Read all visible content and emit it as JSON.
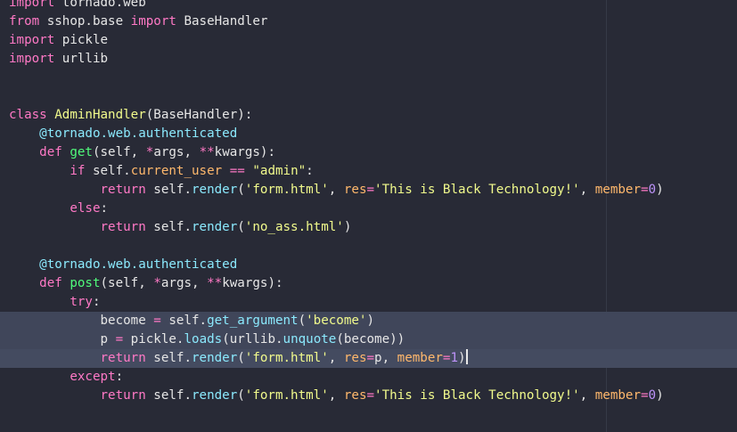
{
  "editor": {
    "language": "python",
    "lines": [
      {
        "tokens": [
          {
            "t": "import",
            "c": "kw"
          },
          {
            "t": " tornado.web",
            "c": "plain"
          }
        ]
      },
      {
        "tokens": [
          {
            "t": "from",
            "c": "kw"
          },
          {
            "t": " sshop.base ",
            "c": "plain"
          },
          {
            "t": "import",
            "c": "kw"
          },
          {
            "t": " BaseHandler",
            "c": "plain"
          }
        ]
      },
      {
        "tokens": [
          {
            "t": "import",
            "c": "kw"
          },
          {
            "t": " pickle",
            "c": "plain"
          }
        ]
      },
      {
        "tokens": [
          {
            "t": "import",
            "c": "kw"
          },
          {
            "t": " urllib",
            "c": "plain"
          }
        ]
      },
      {
        "tokens": []
      },
      {
        "tokens": []
      },
      {
        "tokens": [
          {
            "t": "class",
            "c": "kw"
          },
          {
            "t": " ",
            "c": "plain"
          },
          {
            "t": "AdminHandler",
            "c": "cls"
          },
          {
            "t": "(BaseHandler):",
            "c": "plain"
          }
        ]
      },
      {
        "tokens": [
          {
            "t": "    ",
            "c": "plain"
          },
          {
            "t": "@tornado.web.authenticated",
            "c": "fn"
          }
        ]
      },
      {
        "tokens": [
          {
            "t": "    ",
            "c": "plain"
          },
          {
            "t": "def",
            "c": "kw"
          },
          {
            "t": " ",
            "c": "plain"
          },
          {
            "t": "get",
            "c": "dec"
          },
          {
            "t": "(self, ",
            "c": "plain"
          },
          {
            "t": "*",
            "c": "op"
          },
          {
            "t": "args, ",
            "c": "plain"
          },
          {
            "t": "**",
            "c": "op"
          },
          {
            "t": "kwargs):",
            "c": "plain"
          }
        ]
      },
      {
        "tokens": [
          {
            "t": "        ",
            "c": "plain"
          },
          {
            "t": "if",
            "c": "kw"
          },
          {
            "t": " self.",
            "c": "plain"
          },
          {
            "t": "current_user",
            "c": "attr"
          },
          {
            "t": " ",
            "c": "plain"
          },
          {
            "t": "==",
            "c": "op"
          },
          {
            "t": " ",
            "c": "plain"
          },
          {
            "t": "\"admin\"",
            "c": "str"
          },
          {
            "t": ":",
            "c": "plain"
          }
        ]
      },
      {
        "tokens": [
          {
            "t": "            ",
            "c": "plain"
          },
          {
            "t": "return",
            "c": "kw"
          },
          {
            "t": " self.",
            "c": "plain"
          },
          {
            "t": "render",
            "c": "call"
          },
          {
            "t": "(",
            "c": "plain"
          },
          {
            "t": "'form.html'",
            "c": "str"
          },
          {
            "t": ", ",
            "c": "plain"
          },
          {
            "t": "res",
            "c": "kwarg"
          },
          {
            "t": "=",
            "c": "op"
          },
          {
            "t": "'This is Black Technology!'",
            "c": "str"
          },
          {
            "t": ", ",
            "c": "plain"
          },
          {
            "t": "member",
            "c": "kwarg"
          },
          {
            "t": "=",
            "c": "op"
          },
          {
            "t": "0",
            "c": "num"
          },
          {
            "t": ")",
            "c": "plain"
          }
        ]
      },
      {
        "tokens": [
          {
            "t": "        ",
            "c": "plain"
          },
          {
            "t": "else",
            "c": "kw"
          },
          {
            "t": ":",
            "c": "plain"
          }
        ]
      },
      {
        "tokens": [
          {
            "t": "            ",
            "c": "plain"
          },
          {
            "t": "return",
            "c": "kw"
          },
          {
            "t": " self.",
            "c": "plain"
          },
          {
            "t": "render",
            "c": "call"
          },
          {
            "t": "(",
            "c": "plain"
          },
          {
            "t": "'no_ass.html'",
            "c": "str"
          },
          {
            "t": ")",
            "c": "plain"
          }
        ]
      },
      {
        "tokens": []
      },
      {
        "tokens": [
          {
            "t": "    ",
            "c": "plain"
          },
          {
            "t": "@tornado.web.authenticated",
            "c": "fn"
          }
        ]
      },
      {
        "tokens": [
          {
            "t": "    ",
            "c": "plain"
          },
          {
            "t": "def",
            "c": "kw"
          },
          {
            "t": " ",
            "c": "plain"
          },
          {
            "t": "post",
            "c": "dec"
          },
          {
            "t": "(self, ",
            "c": "plain"
          },
          {
            "t": "*",
            "c": "op"
          },
          {
            "t": "args, ",
            "c": "plain"
          },
          {
            "t": "**",
            "c": "op"
          },
          {
            "t": "kwargs):",
            "c": "plain"
          }
        ]
      },
      {
        "tokens": [
          {
            "t": "        ",
            "c": "plain"
          },
          {
            "t": "try",
            "c": "kw"
          },
          {
            "t": ":",
            "c": "plain"
          }
        ]
      },
      {
        "selected": true,
        "tokens": [
          {
            "t": "            become ",
            "c": "plain"
          },
          {
            "t": "=",
            "c": "op"
          },
          {
            "t": " self.",
            "c": "plain"
          },
          {
            "t": "get_argument",
            "c": "call"
          },
          {
            "t": "(",
            "c": "plain"
          },
          {
            "t": "'become'",
            "c": "str"
          },
          {
            "t": ")",
            "c": "plain"
          }
        ]
      },
      {
        "selected": true,
        "tokens": [
          {
            "t": "            p ",
            "c": "plain"
          },
          {
            "t": "=",
            "c": "op"
          },
          {
            "t": " pickle.",
            "c": "plain"
          },
          {
            "t": "loads",
            "c": "call"
          },
          {
            "t": "(urllib.",
            "c": "plain"
          },
          {
            "t": "unquote",
            "c": "call"
          },
          {
            "t": "(become))",
            "c": "plain"
          }
        ]
      },
      {
        "selected": true,
        "cursor": true,
        "tokens": [
          {
            "t": "            ",
            "c": "plain"
          },
          {
            "t": "return",
            "c": "kw"
          },
          {
            "t": " self.",
            "c": "plain"
          },
          {
            "t": "render",
            "c": "call"
          },
          {
            "t": "(",
            "c": "plain"
          },
          {
            "t": "'form.html'",
            "c": "str"
          },
          {
            "t": ", ",
            "c": "plain"
          },
          {
            "t": "res",
            "c": "kwarg"
          },
          {
            "t": "=",
            "c": "op"
          },
          {
            "t": "p, ",
            "c": "plain"
          },
          {
            "t": "member",
            "c": "kwarg"
          },
          {
            "t": "=",
            "c": "op"
          },
          {
            "t": "1",
            "c": "num"
          },
          {
            "t": ")",
            "c": "plain"
          }
        ]
      },
      {
        "tokens": [
          {
            "t": "        ",
            "c": "plain"
          },
          {
            "t": "except",
            "c": "kw"
          },
          {
            "t": ":",
            "c": "plain"
          }
        ]
      },
      {
        "tokens": [
          {
            "t": "            ",
            "c": "plain"
          },
          {
            "t": "return",
            "c": "kw"
          },
          {
            "t": " self.",
            "c": "plain"
          },
          {
            "t": "render",
            "c": "call"
          },
          {
            "t": "(",
            "c": "plain"
          },
          {
            "t": "'form.html'",
            "c": "str"
          },
          {
            "t": ", ",
            "c": "plain"
          },
          {
            "t": "res",
            "c": "kwarg"
          },
          {
            "t": "=",
            "c": "op"
          },
          {
            "t": "'This is Black Technology!'",
            "c": "str"
          },
          {
            "t": ", ",
            "c": "plain"
          },
          {
            "t": "member",
            "c": "kwarg"
          },
          {
            "t": "=",
            "c": "op"
          },
          {
            "t": "0",
            "c": "num"
          },
          {
            "t": ")",
            "c": "plain"
          }
        ]
      },
      {
        "tokens": []
      }
    ]
  }
}
